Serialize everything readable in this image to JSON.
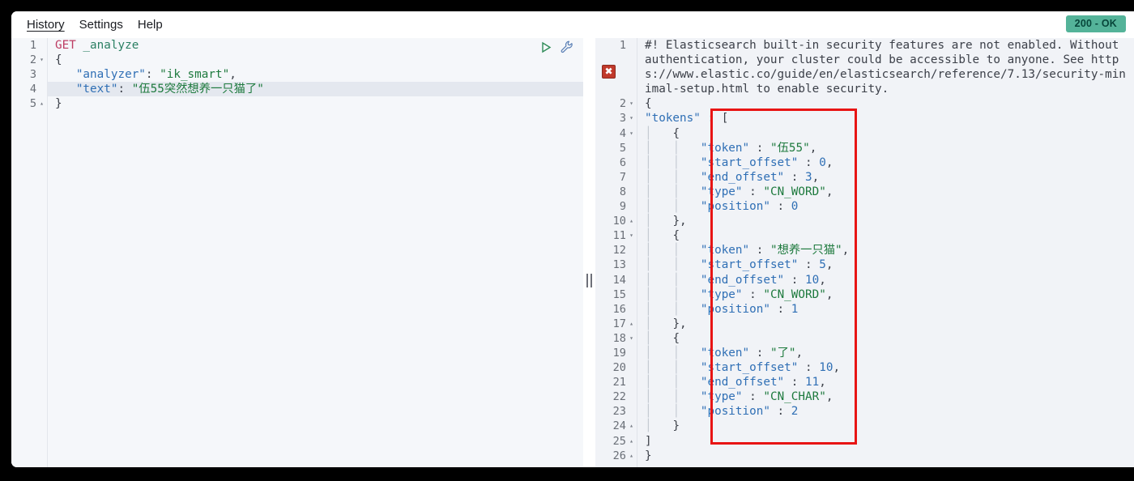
{
  "window": {
    "status_badge": "200 - OK"
  },
  "menu": {
    "items": [
      {
        "label": "History",
        "active": true
      },
      {
        "label": "Settings",
        "active": false
      },
      {
        "label": "Help",
        "active": false
      }
    ]
  },
  "request_editor": {
    "icons": {
      "run": "play-icon",
      "wrench": "wrench-icon"
    },
    "line_numbers": [
      "1",
      "2",
      "3",
      "4",
      "5"
    ],
    "folds": [
      "",
      "▾",
      "",
      "",
      "▴"
    ],
    "highlighted_line": 4,
    "lines": [
      {
        "n": "1",
        "method": "GET",
        "url": " _analyze"
      },
      {
        "n": "2",
        "text": "{"
      },
      {
        "n": "3",
        "key": "\"analyzer\"",
        "sep": ": ",
        "value": "\"ik_smart\"",
        "tail": ","
      },
      {
        "n": "4",
        "key": "\"text\"",
        "sep": ": ",
        "value": "\"伍55突然想养一只猫了\"",
        "tail": ""
      },
      {
        "n": "5",
        "text": "}"
      }
    ]
  },
  "response_editor": {
    "warning": "#! Elasticsearch built-in security features are not enabled. Without authentication, your cluster could be accessible to anyone. See https://www.elastic.co/guide/en/elasticsearch/reference/7.13/security-minimal-setup.html to enable security.",
    "error_marker": "error-x-icon",
    "line_numbers": [
      "1",
      "2",
      "3",
      "4",
      "5",
      "6",
      "7",
      "8",
      "9",
      "10",
      "11",
      "12",
      "13",
      "14",
      "15",
      "16",
      "17",
      "18",
      "19",
      "20",
      "21",
      "22",
      "23",
      "24",
      "25",
      "26"
    ],
    "body_lines": [
      {
        "n": "2",
        "fold": "▾",
        "guides": 0,
        "text": "{",
        "kind": "punc"
      },
      {
        "n": "3",
        "fold": "▾",
        "guides": 0,
        "key": "\"tokens\"",
        "sep": " : ",
        "value": "[",
        "kind": "kv"
      },
      {
        "n": "4",
        "fold": "▾",
        "guides": 1,
        "text": "{",
        "kind": "punc"
      },
      {
        "n": "5",
        "fold": "",
        "guides": 2,
        "key": "\"token\"",
        "sep": " : ",
        "value": "\"伍55\"",
        "tail": ",",
        "kind": "kv-str"
      },
      {
        "n": "6",
        "fold": "",
        "guides": 2,
        "key": "\"start_offset\"",
        "sep": " : ",
        "value": "0",
        "tail": ",",
        "kind": "kv-num"
      },
      {
        "n": "7",
        "fold": "",
        "guides": 2,
        "key": "\"end_offset\"",
        "sep": " : ",
        "value": "3",
        "tail": ",",
        "kind": "kv-num"
      },
      {
        "n": "8",
        "fold": "",
        "guides": 2,
        "key": "\"type\"",
        "sep": " : ",
        "value": "\"CN_WORD\"",
        "tail": ",",
        "kind": "kv-str"
      },
      {
        "n": "9",
        "fold": "",
        "guides": 2,
        "key": "\"position\"",
        "sep": " : ",
        "value": "0",
        "tail": "",
        "kind": "kv-num"
      },
      {
        "n": "10",
        "fold": "▴",
        "guides": 1,
        "text": "},",
        "kind": "punc"
      },
      {
        "n": "11",
        "fold": "▾",
        "guides": 1,
        "text": "{",
        "kind": "punc"
      },
      {
        "n": "12",
        "fold": "",
        "guides": 2,
        "key": "\"token\"",
        "sep": " : ",
        "value": "\"想养一只猫\"",
        "tail": ",",
        "kind": "kv-str"
      },
      {
        "n": "13",
        "fold": "",
        "guides": 2,
        "key": "\"start_offset\"",
        "sep": " : ",
        "value": "5",
        "tail": ",",
        "kind": "kv-num"
      },
      {
        "n": "14",
        "fold": "",
        "guides": 2,
        "key": "\"end_offset\"",
        "sep": " : ",
        "value": "10",
        "tail": ",",
        "kind": "kv-num"
      },
      {
        "n": "15",
        "fold": "",
        "guides": 2,
        "key": "\"type\"",
        "sep": " : ",
        "value": "\"CN_WORD\"",
        "tail": ",",
        "kind": "kv-str"
      },
      {
        "n": "16",
        "fold": "",
        "guides": 2,
        "key": "\"position\"",
        "sep": " : ",
        "value": "1",
        "tail": "",
        "kind": "kv-num"
      },
      {
        "n": "17",
        "fold": "▴",
        "guides": 1,
        "text": "},",
        "kind": "punc"
      },
      {
        "n": "18",
        "fold": "▾",
        "guides": 1,
        "text": "{",
        "kind": "punc"
      },
      {
        "n": "19",
        "fold": "",
        "guides": 2,
        "key": "\"token\"",
        "sep": " : ",
        "value": "\"了\"",
        "tail": ",",
        "kind": "kv-str"
      },
      {
        "n": "20",
        "fold": "",
        "guides": 2,
        "key": "\"start_offset\"",
        "sep": " : ",
        "value": "10",
        "tail": ",",
        "kind": "kv-num"
      },
      {
        "n": "21",
        "fold": "",
        "guides": 2,
        "key": "\"end_offset\"",
        "sep": " : ",
        "value": "11",
        "tail": ",",
        "kind": "kv-num"
      },
      {
        "n": "22",
        "fold": "",
        "guides": 2,
        "key": "\"type\"",
        "sep": " : ",
        "value": "\"CN_CHAR\"",
        "tail": ",",
        "kind": "kv-str"
      },
      {
        "n": "23",
        "fold": "",
        "guides": 2,
        "key": "\"position\"",
        "sep": " : ",
        "value": "2",
        "tail": "",
        "kind": "kv-num"
      },
      {
        "n": "24",
        "fold": "▴",
        "guides": 1,
        "text": "}",
        "kind": "punc"
      },
      {
        "n": "25",
        "fold": "▴",
        "guides": 0,
        "text": "]",
        "kind": "punc"
      },
      {
        "n": "26",
        "fold": "▴",
        "guides": 0,
        "text": "}",
        "kind": "punc"
      }
    ]
  },
  "annotation": {
    "shape": "rectangle",
    "color": "#e81414"
  },
  "colors": {
    "badge_bg": "#54b399",
    "annotation": "#e81414",
    "method": "#bd3d63",
    "string": "#1e7a3e",
    "key": "#2f6fb5"
  }
}
